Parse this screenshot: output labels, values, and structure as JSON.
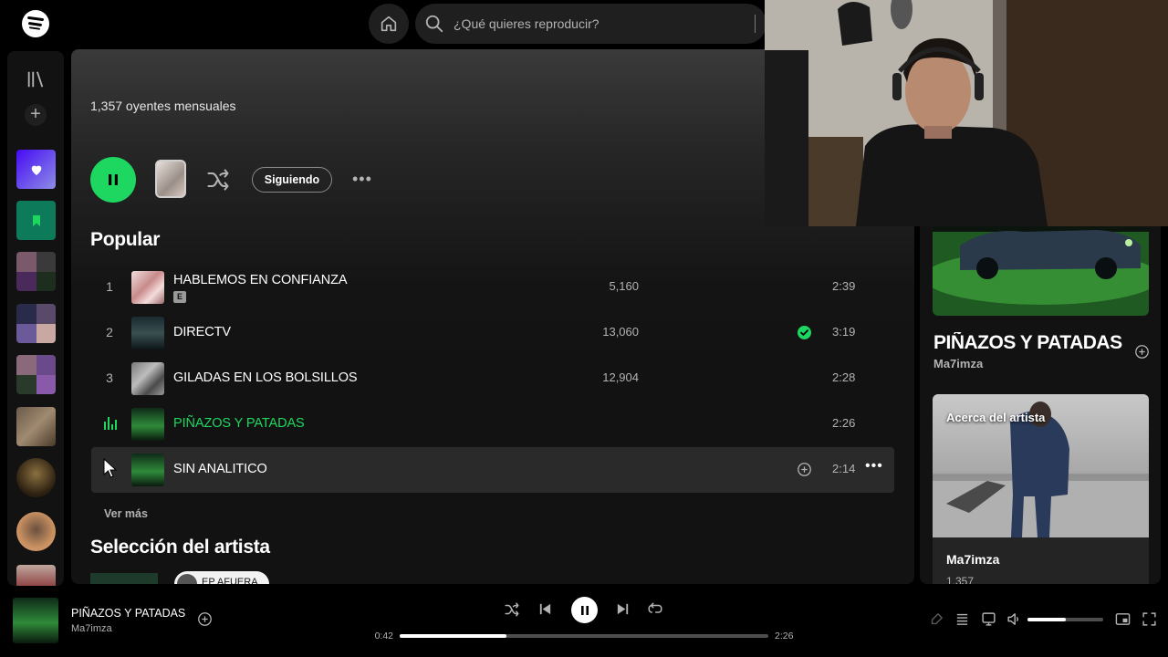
{
  "search": {
    "placeholder": "¿Qué quieres reproducir?"
  },
  "artist": {
    "monthly_listeners": "1,357 oyentes mensuales",
    "follow_label": "Siguiendo"
  },
  "popular": {
    "heading": "Popular",
    "tracks": [
      {
        "num": "1",
        "title": "HABLEMOS EN CONFIANZA",
        "explicit": "E",
        "plays": "5,160",
        "duration": "2:39",
        "saved": false
      },
      {
        "num": "2",
        "title": "DIRECTV",
        "plays": "13,060",
        "duration": "3:19",
        "saved": true
      },
      {
        "num": "3",
        "title": "GILADAS EN LOS BOLSILLOS",
        "plays": "12,904",
        "duration": "2:28",
        "saved": false
      },
      {
        "num": "4",
        "title": "PIÑAZOS Y PATADAS",
        "plays": "",
        "duration": "2:26",
        "saved": false,
        "playing": true
      },
      {
        "num": "5",
        "title": "SIN ANALITICO",
        "plays": "",
        "duration": "2:14",
        "saved": false,
        "hover": true
      }
    ],
    "see_more": "Ver más"
  },
  "artist_pick": {
    "heading": "Selección del artista",
    "chip_label": "EP AFUERA"
  },
  "now_playing_panel": {
    "title": "PIÑAZOS Y PATADAS",
    "artist": "Ma7imza",
    "about_label": "Acerca del artista",
    "about_name": "Ma7imza",
    "about_listeners": "1,357"
  },
  "player": {
    "title": "PIÑAZOS Y PATADAS",
    "artist": "Ma7imza",
    "current_time": "0:42",
    "total_time": "2:26",
    "progress": 0.29,
    "volume": 0.5
  },
  "colors": {
    "accent": "#1ed760",
    "background": "#121212",
    "hover_row": "#2a2a2a"
  },
  "icons": [
    "spotify-logo",
    "home-icon",
    "search-icon",
    "library-icon",
    "plus-icon",
    "heart-icon",
    "bookmark-icon",
    "pause-icon",
    "shuffle-icon",
    "more-icon",
    "check-icon",
    "add-circle-icon",
    "previous-icon",
    "next-icon",
    "repeat-icon",
    "lyrics-icon",
    "queue-icon",
    "device-icon",
    "volume-icon",
    "miniplayer-icon",
    "fullscreen-icon",
    "cursor-icon"
  ]
}
